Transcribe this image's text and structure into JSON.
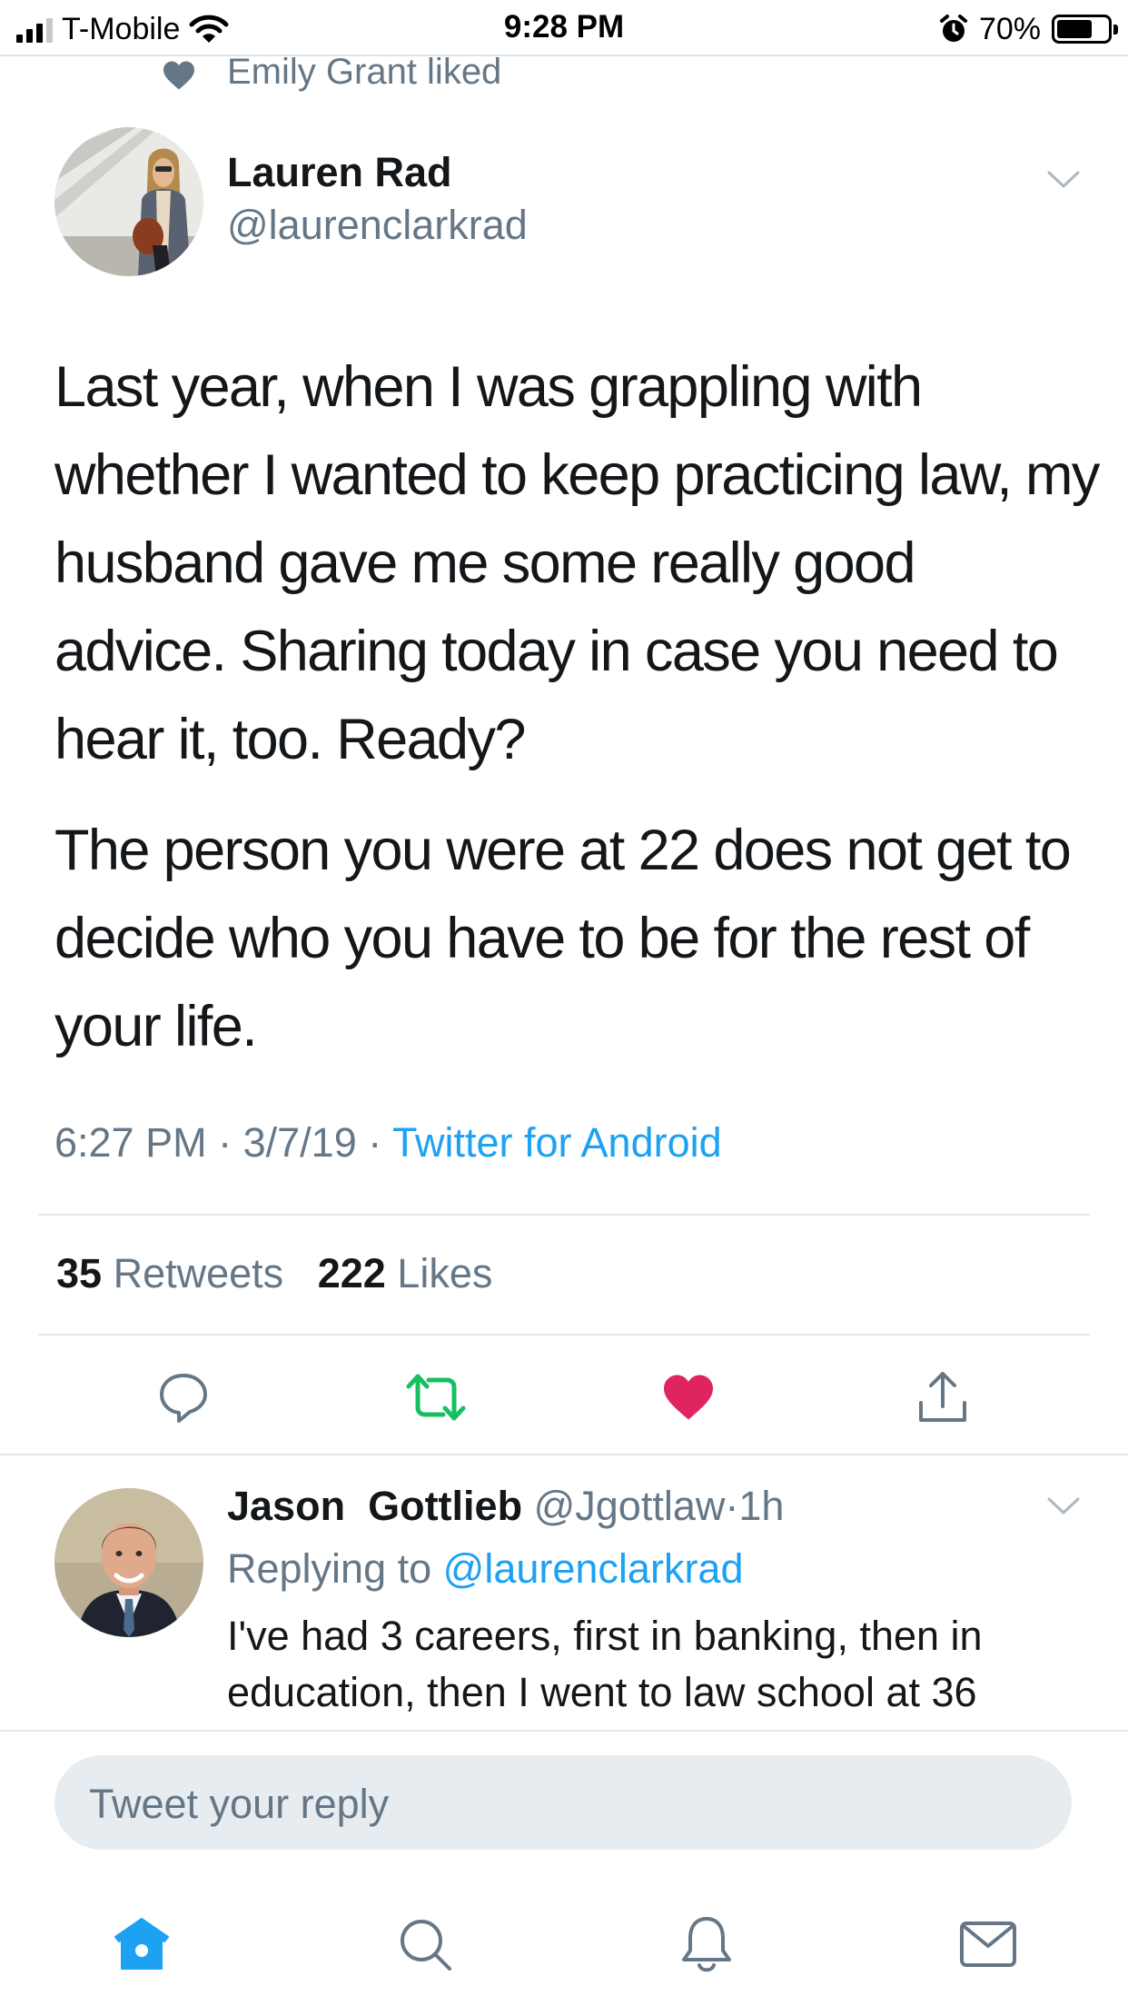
{
  "status_bar": {
    "carrier": "T-Mobile",
    "time": "9:28 PM",
    "battery_percent": "70%",
    "battery_level": 0.7,
    "icons": [
      "signal-icon",
      "wifi-icon",
      "alarm-icon",
      "battery-icon"
    ]
  },
  "social_context": {
    "icon": "heart-icon",
    "text": "Emily Grant liked"
  },
  "tweet": {
    "author_name": "Lauren Rad",
    "author_handle": "@laurenclarkrad",
    "paragraphs": [
      "Last year, when I was grappling with whether I wanted to keep practicing law, my husband gave me some really good advice. Sharing today in case you need to hear it, too. Ready?",
      "The person you were at 22 does not get to decide who you have to be for the rest of your life."
    ],
    "time": "6:27 PM",
    "date": "3/7/19",
    "separator": "·",
    "client": "Twitter for Android",
    "retweets_count": "35",
    "retweets_label": "Retweets",
    "likes_count": "222",
    "likes_label": "Likes",
    "liked": true
  },
  "actions": [
    "reply-icon",
    "retweet-icon",
    "like-icon",
    "share-icon"
  ],
  "reply": {
    "author_first": "Jason",
    "author_last": "Gottlieb",
    "author_handle": "@Jgottlaw",
    "time_ago": "1h",
    "replying_label": "Replying to",
    "replying_to": "@laurenclarkrad",
    "text": "I've had 3 careers, first in banking, then in education, then I went to law school at 36"
  },
  "compose": {
    "placeholder": "Tweet your reply"
  },
  "tab_bar": [
    "home-icon",
    "search-icon",
    "notifications-icon",
    "messages-icon"
  ],
  "colors": {
    "accent": "#1da1f2",
    "like": "#e0245e",
    "retweet": "#17bf63",
    "muted": "#657786",
    "text": "#14171a"
  }
}
